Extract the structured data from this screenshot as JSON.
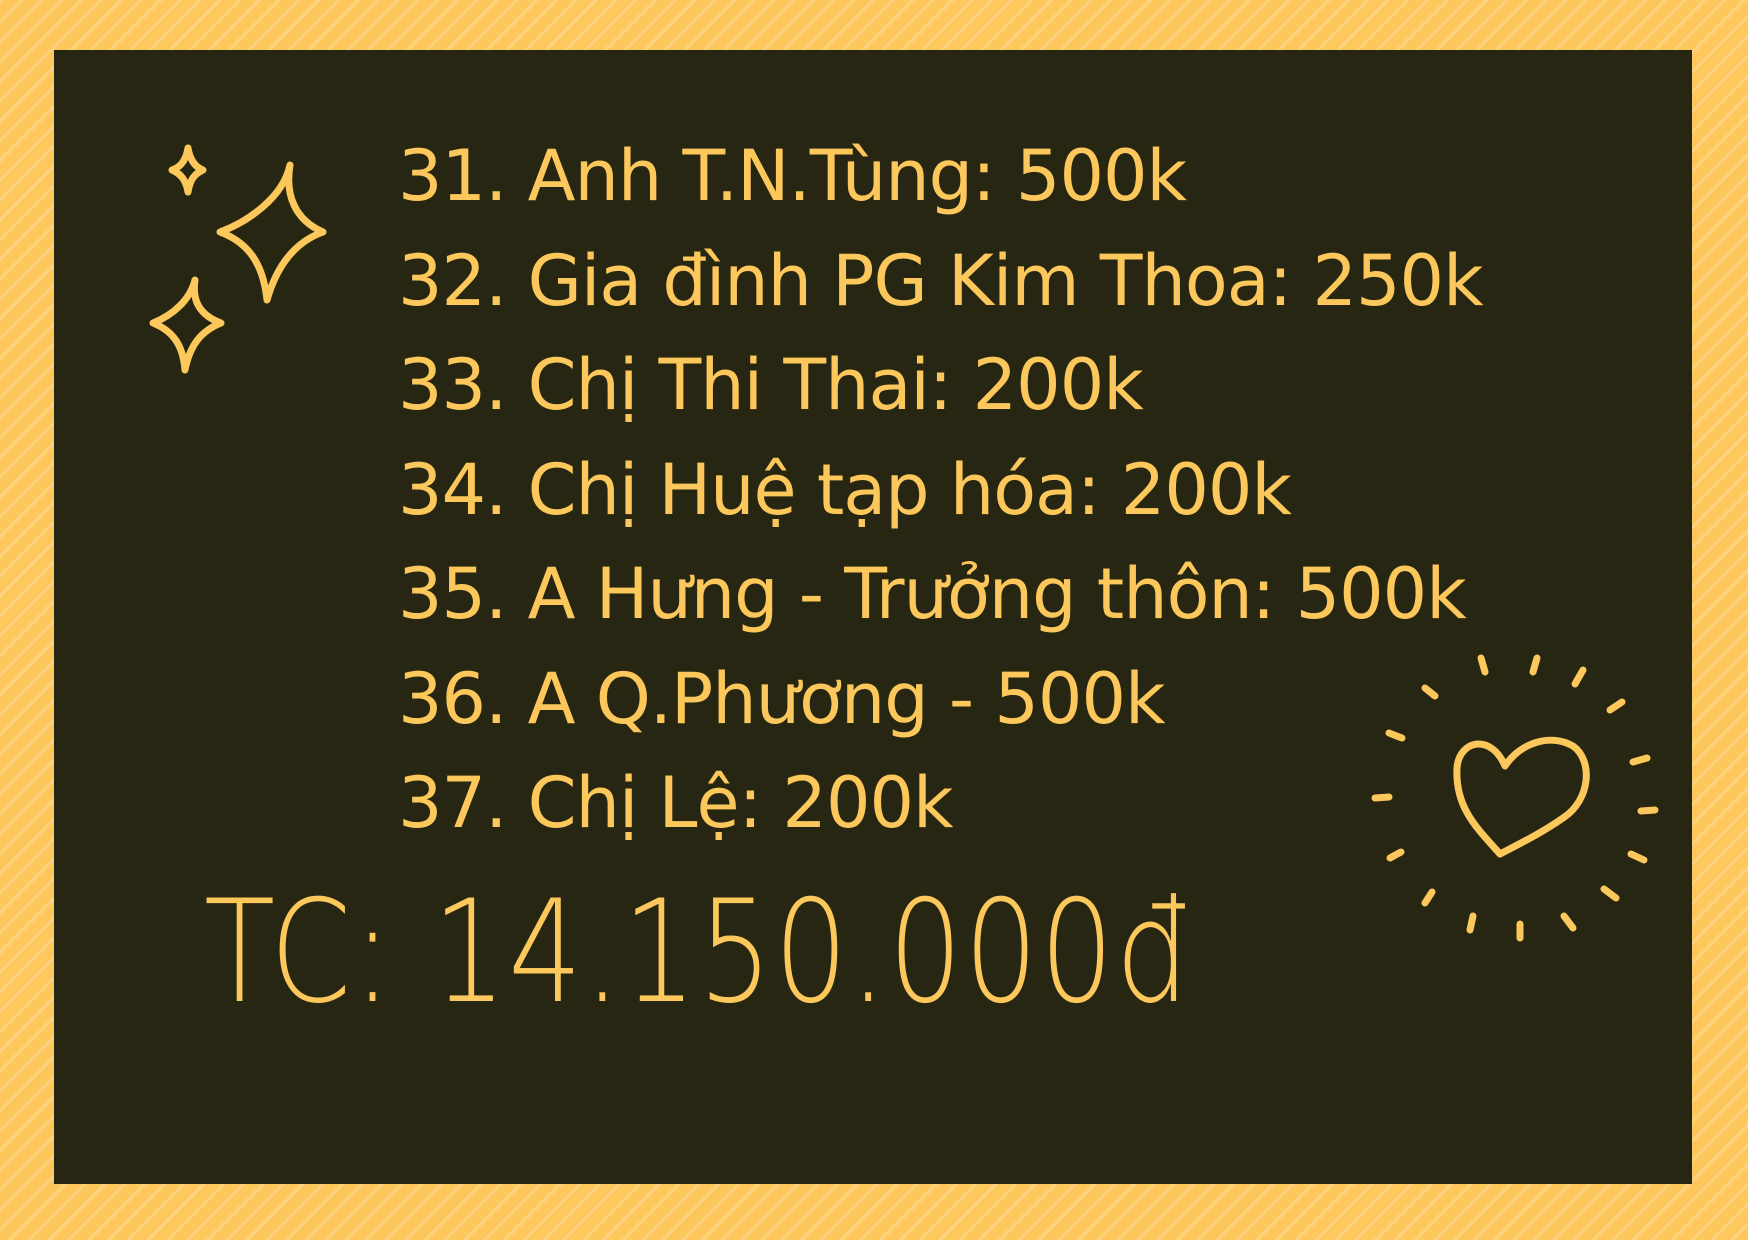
{
  "donors": [
    "31. Anh T.N.Tùng: 500k",
    "32. Gia đình PG Kim Thoa: 250k",
    "33. Chị Thi Thai: 200k",
    "34. Chị Huệ tạp hóa: 200k",
    "35. A Hưng - Trưởng thôn: 500k",
    "36. A Q.Phương - 500k",
    "37. Chị Lệ: 200k"
  ],
  "total": "TC: 14.150.000đ",
  "icons": {
    "sparkles": "sparkles-icon",
    "heart": "heart-with-rays-icon"
  },
  "colors": {
    "border": "#fdc75c",
    "board": "#272612",
    "text": "#fcc75b"
  }
}
